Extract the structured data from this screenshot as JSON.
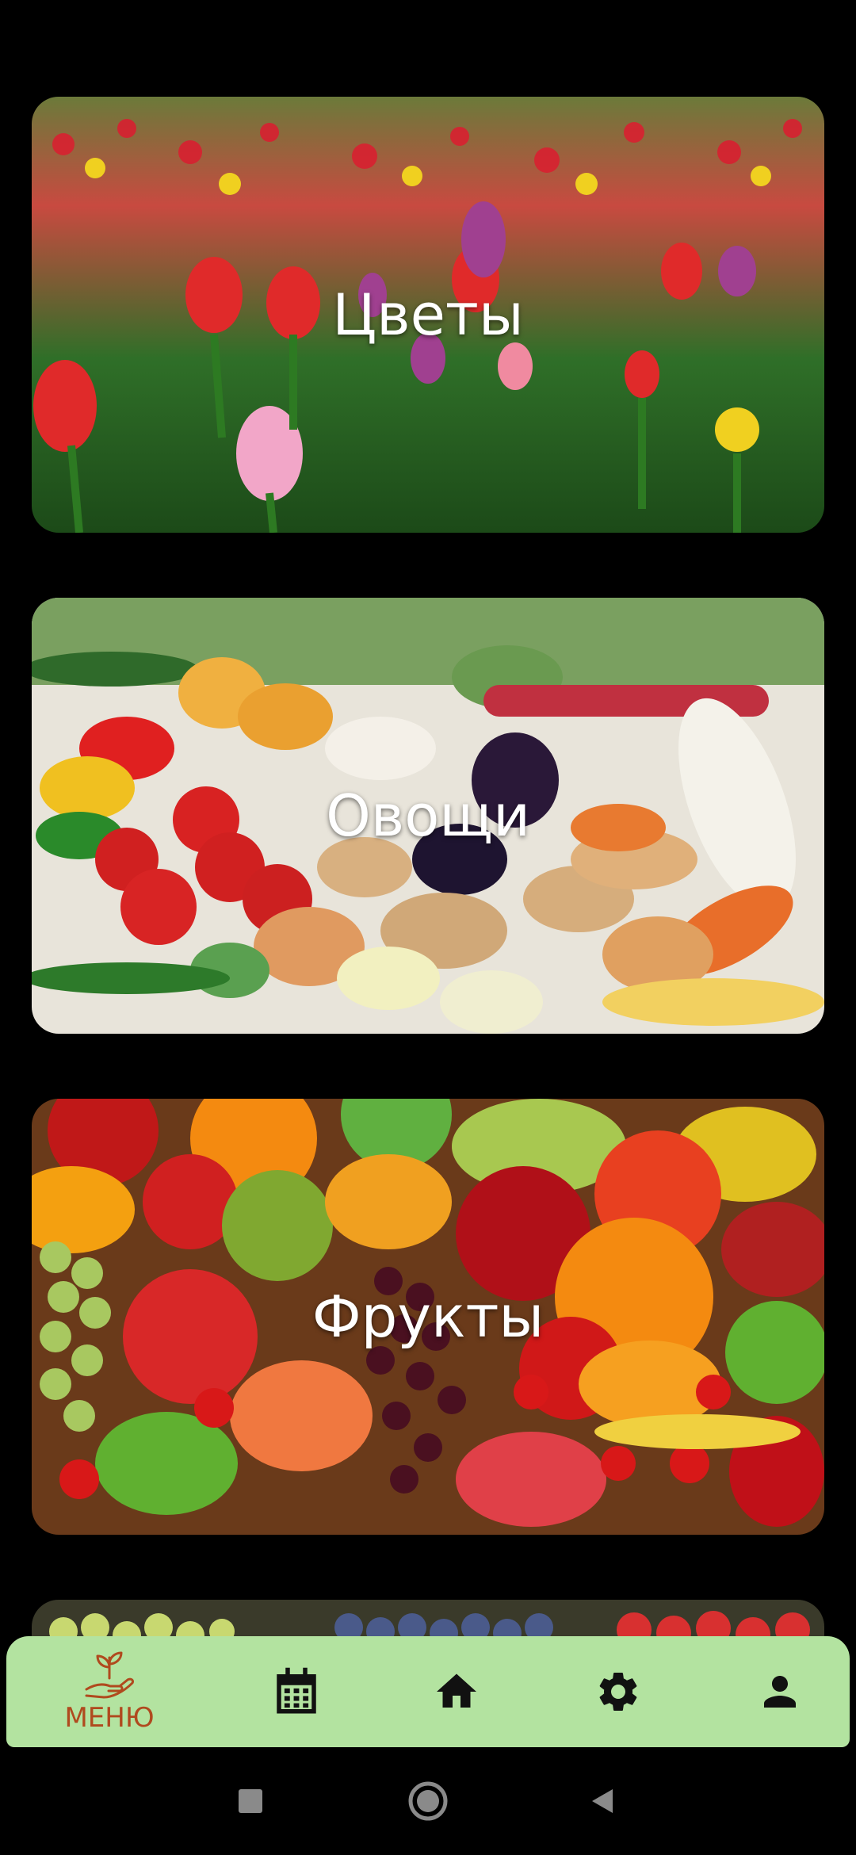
{
  "categories": [
    {
      "label": "Цветы"
    },
    {
      "label": "Овощи"
    },
    {
      "label": "Фрукты"
    }
  ],
  "bottom_nav": {
    "menu_label": "МЕНЮ",
    "icons": [
      "plant-hand-icon",
      "calendar-icon",
      "home-icon",
      "gear-icon",
      "person-icon"
    ]
  },
  "system_nav": {
    "icons": [
      "recents-icon",
      "home-circle-icon",
      "back-icon"
    ]
  },
  "colors": {
    "nav_background": "#b3e3a0",
    "menu_label": "#b04a1e",
    "icon": "#111111",
    "background": "#000000"
  }
}
